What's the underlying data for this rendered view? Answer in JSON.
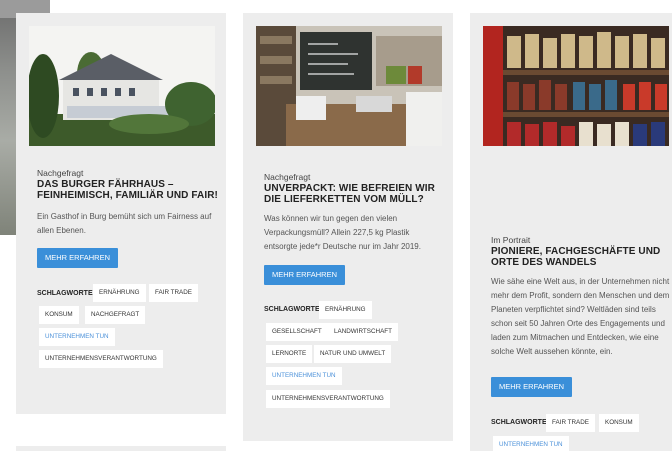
{
  "cards": [
    {
      "kicker": "Nachgefragt",
      "title": "DAS BURGER FÄHRHAUS – FEINHEIMISCH, FAMILIÄR UND FAIR!",
      "description": "Ein Gasthof in Burg bemüht sich um Fairness auf allen Ebenen.",
      "button": "MEHR ERFAHREN",
      "tags_label": "SCHLAGWORTE:",
      "tags": [
        "ERNÄHRUNG",
        "FAIR TRADE",
        "KONSUM",
        "NACHGEFRAGT",
        "UNTERNEHMEN TUN",
        "UNTERNEHMENSVERANTWORTUNG"
      ]
    },
    {
      "kicker": "Nachgefragt",
      "title": "UNVERPACKT: WIE BEFREIEN WIR DIE LIEFERKETTEN VOM MÜLL?",
      "description": "Was können wir tun gegen den vielen Verpackungsmüll? Allein 227,5 kg Plastik entsorgte jede*r Deutsche nur im Jahr 2019.",
      "button": "MEHR ERFAHREN",
      "tags_label": "SCHLAGWORTE:",
      "tags": [
        "ERNÄHRUNG",
        "GESELLSCHAFT",
        "LANDWIRTSCHAFT",
        "LERNORTE",
        "NATUR UND UMWELT",
        "UNTERNEHMEN TUN",
        "UNTERNEHMENSVERANTWORTUNG"
      ]
    },
    {
      "kicker": "Im Portrait",
      "title": "PIONIERE, FACHGESCHÄFTE UND ORTE DES WANDELS",
      "description": "Wie sähe eine Welt aus, in der Unternehmen nicht mehr dem Profit, sondern den Menschen und dem Planeten verpflichtet sind? Weltläden sind teils schon seit 50 Jahren Orte des Engagements und laden zum Mitmachen und Entdecken, wie eine solche Welt aussehen könnte, ein.",
      "button": "MEHR ERFAHREN",
      "tags_label": "SCHLAGWORTE:",
      "tags": [
        "FAIR TRADE",
        "KONSUM",
        "UNTERNEHMEN TUN"
      ]
    }
  ]
}
